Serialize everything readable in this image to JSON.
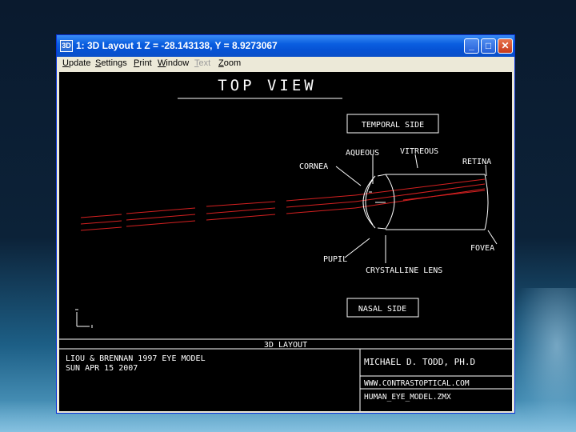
{
  "window": {
    "app_icon": "3D",
    "title": "1: 3D Layout 1 Z = -28.143138, Y = 8.9273067",
    "minimize_glyph": "_",
    "maximize_glyph": "□",
    "close_glyph": "✕"
  },
  "menu": {
    "items": [
      {
        "key": "U",
        "rest": "pdate"
      },
      {
        "key": "S",
        "rest": "ettings"
      },
      {
        "key": "P",
        "rest": "rint"
      },
      {
        "key": "W",
        "rest": "indow"
      },
      {
        "key": "T",
        "rest": "ext"
      },
      {
        "key": "Z",
        "rest": "oom"
      }
    ]
  },
  "layout": {
    "view_title": "TOP VIEW",
    "temporal_label": "TEMPORAL SIDE",
    "nasal_label": "NASAL SIDE",
    "labels": {
      "aqueous": "AQUEOUS",
      "vitreous": "VITREOUS",
      "cornea": "CORNEA",
      "retina": "RETINA",
      "pupil": "PUPIL",
      "fovea": "FOVEA",
      "crystalline_lens": "CRYSTALLINE LENS"
    },
    "footer": {
      "header": "3D LAYOUT",
      "model": "LIOU & BRENNAN 1997 EYE MODEL",
      "date": "SUN APR 15 2007",
      "author": "MICHAEL D. TODD, PH.D",
      "website": "WWW.CONTRASTOPTICAL.COM",
      "file": "HUMAN_EYE_MODEL.ZMX"
    }
  },
  "colors": {
    "ray": "#d42020",
    "lines": "#ffffff",
    "canvas": "#000000"
  }
}
